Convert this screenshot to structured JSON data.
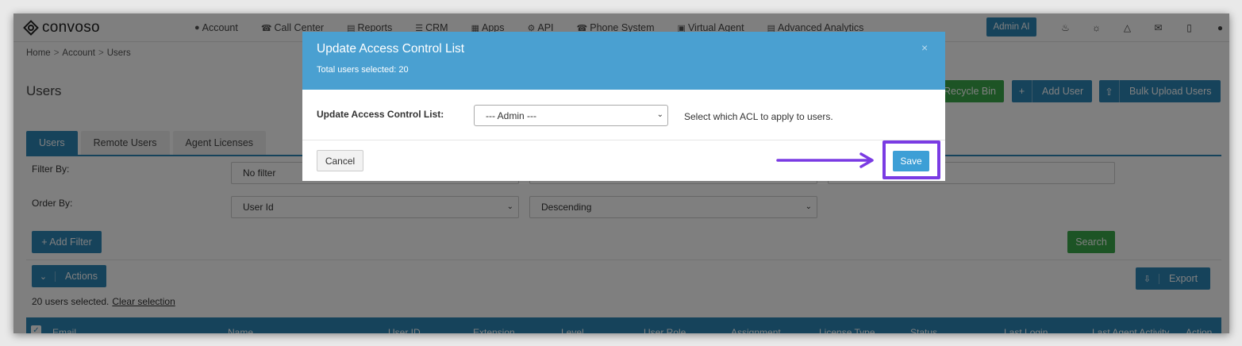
{
  "app": {
    "logo_text": "convoso"
  },
  "nav": {
    "items": [
      {
        "label": "Account",
        "icon": "user-icon"
      },
      {
        "label": "Call Center",
        "icon": "phone-icon"
      },
      {
        "label": "Reports",
        "icon": "bar-chart-icon"
      },
      {
        "label": "CRM",
        "icon": "list-icon"
      },
      {
        "label": "Apps",
        "icon": "grid-icon"
      },
      {
        "label": "API",
        "icon": "gear-icon"
      },
      {
        "label": "Phone System",
        "icon": "phone-icon"
      },
      {
        "label": "Virtual Agent",
        "icon": "monitor-icon"
      },
      {
        "label": "Advanced Analytics",
        "icon": "bar-chart-icon"
      }
    ],
    "admin_ai": "Admin AI",
    "right_icons": [
      "bell-icon",
      "lightbulb-icon",
      "flask-icon",
      "chat-icon",
      "clipboard-icon",
      "user-icon"
    ]
  },
  "breadcrumb": [
    "Home",
    "Account",
    "Users"
  ],
  "page": {
    "title": "Users",
    "recycle_bin": "Recycle Bin",
    "add_user": "Add User",
    "bulk_upload": "Bulk Upload Users"
  },
  "tabs": [
    "Users",
    "Remote Users",
    "Agent Licenses"
  ],
  "filters": {
    "filter_by_label": "Filter By:",
    "filter_value": "No filter",
    "order_by_label": "Order By:",
    "order_field": "User Id",
    "order_direction": "Descending",
    "add_filter": "+ Add Filter",
    "search": "Search"
  },
  "actions": {
    "actions_label": "Actions",
    "export_label": "Export",
    "selection_text": "20 users selected.",
    "clear_selection": "Clear selection"
  },
  "table": {
    "columns": [
      "Email",
      "Name",
      "User ID",
      "Extension",
      "Level",
      "User Role",
      "Assignment",
      "License Type",
      "Status",
      "Last Login",
      "Last Agent Activity",
      "Action"
    ]
  },
  "modal": {
    "title": "Update Access Control List",
    "subtitle": "Total users selected: 20",
    "close": "×",
    "field_label": "Update Access Control List:",
    "select_value": "--- Admin ---",
    "help_text": "Select which ACL to apply to users.",
    "cancel": "Cancel",
    "save": "Save"
  },
  "colors": {
    "primary": "#2c86b7",
    "modal_header": "#4aa0d1",
    "success": "#3aa84a",
    "annotation": "#7a3be3"
  }
}
